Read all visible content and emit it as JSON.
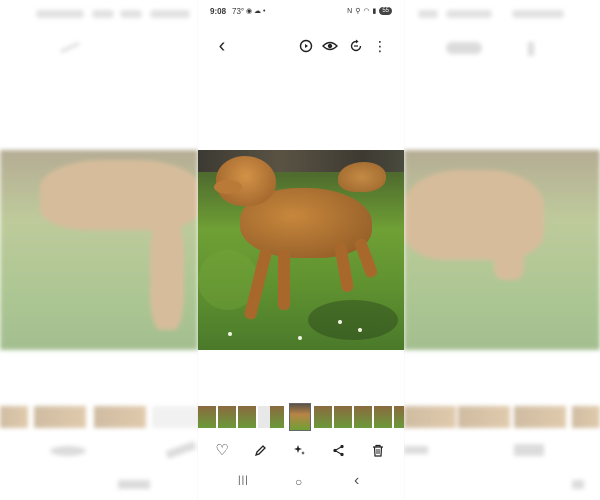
{
  "status_bar": {
    "time": "9:08",
    "temperature": "73°",
    "battery": "55"
  },
  "icons": {
    "back": "‹",
    "remaster": "✧",
    "eye": "◉",
    "rotate": "⟳",
    "more": "⋮",
    "heart": "♡",
    "edit": "✎",
    "effects": "✦",
    "share": "⋖",
    "delete": "🗑",
    "nav_recents": "|||",
    "nav_home": "○",
    "nav_back": "‹"
  },
  "colors": {
    "icon": "#222222",
    "background": "#ffffff"
  }
}
